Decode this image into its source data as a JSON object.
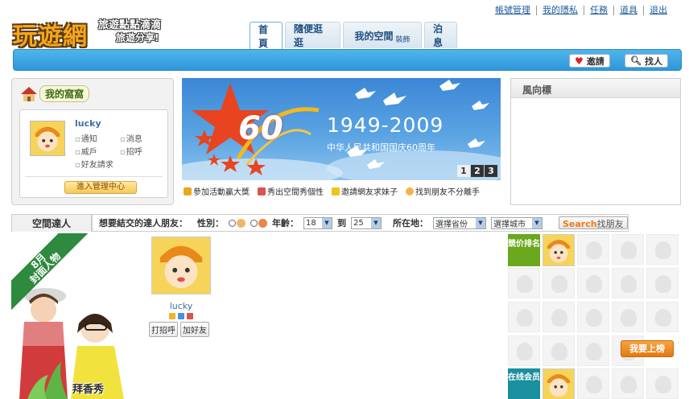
{
  "header": {
    "logo_main": "玩遊網",
    "logo_sub1": "旅遊點點滴滴",
    "logo_sub2": "旅遊分享!",
    "top_links": [
      "帳號管理",
      "我的隱私",
      "任務",
      "道具",
      "退出"
    ]
  },
  "tabs": [
    {
      "label": "首頁",
      "active": true
    },
    {
      "label": "隨便逛逛",
      "active": false
    },
    {
      "label": "我的空間",
      "sub": "裝飾",
      "active": false
    },
    {
      "label": "泊息",
      "active": false
    }
  ],
  "navbar": {
    "invite_label": "邀請",
    "find_label": "找人"
  },
  "nest": {
    "title": "我的窩窩",
    "username": "lucky",
    "links": [
      "通知",
      "消息",
      "威戶",
      "招呼",
      "好友請求"
    ],
    "manage_button": "進入管理中心"
  },
  "banner": {
    "big_number": "60",
    "years": "1949-2009",
    "slogan": "中华人民共和国国庆60周年",
    "pages": [
      "1",
      "2",
      "3"
    ],
    "active_page": "1"
  },
  "banner_links": [
    "參加活動贏大獎",
    "秀出空間秀個性",
    "邀請網友求妹子",
    "找到朋友不分離手"
  ],
  "vane": {
    "title": "風向標"
  },
  "filter": {
    "tab_label": "空間達人",
    "prompt": "想要結交的達人朋友：",
    "gender_label": "性別：",
    "age_label": "年齡：",
    "age_from": "18",
    "age_to_label": "到",
    "age_to": "25",
    "location_label": "所在地：",
    "province_select": "選擇省份",
    "city_select": "選擇城市",
    "search_label": "Search",
    "search_sub": "找朋友"
  },
  "cover": {
    "month": "8月",
    "title": "封面人物",
    "caption": "拜香秀"
  },
  "featured_user": {
    "name": "lucky",
    "greet_button": "打招呼",
    "add_friend_button": "加好友"
  },
  "grid": {
    "rank_label": "競价排名",
    "online_label": "在线会员",
    "join_button": "我要上榜"
  },
  "colors": {
    "brand_blue": "#3aa4e4",
    "logo_orange": "#f6a51c",
    "join_orange": "#e37912",
    "rank_green": "#6aa81d",
    "online_teal": "#1a8f9e"
  }
}
